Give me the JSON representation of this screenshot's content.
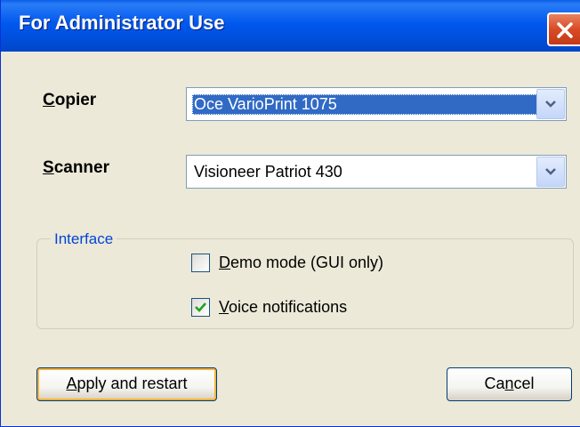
{
  "window": {
    "title": "For Administrator Use",
    "close_icon": "close-icon"
  },
  "copier": {
    "label_first": "C",
    "label_rest": "opier",
    "selected": "Oce VarioPrint 1075"
  },
  "scanner": {
    "label_first": "S",
    "label_rest": "canner",
    "selected": "Visioneer Patriot 430"
  },
  "interface": {
    "caption": "Interface",
    "demo_mode": {
      "first": "D",
      "rest": "emo mode (GUI only)",
      "checked": false
    },
    "voice": {
      "first": "V",
      "rest": "oice notifications",
      "checked": true
    }
  },
  "buttons": {
    "apply": {
      "first": "A",
      "rest": "pply and restart"
    },
    "cancel": {
      "before": "Ca",
      "key": "n",
      "after": "cel"
    }
  },
  "colors": {
    "titlebar": "#0058EE",
    "close_button": "#D94A25",
    "selection": "#316AC5",
    "group_caption": "#0046D5",
    "checkmark": "#21A121"
  }
}
